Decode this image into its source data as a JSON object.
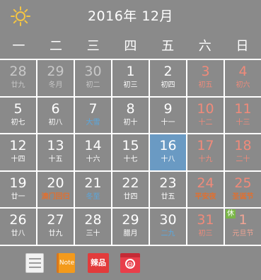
{
  "header": {
    "title": "2016年 12月",
    "weather_icon": "sun-icon"
  },
  "weekdays": [
    "一",
    "二",
    "三",
    "四",
    "五",
    "六",
    "日"
  ],
  "days": [
    {
      "num": "28",
      "lunar": "廿九",
      "other": true
    },
    {
      "num": "29",
      "lunar": "冬月",
      "other": true
    },
    {
      "num": "30",
      "lunar": "初二",
      "other": true
    },
    {
      "num": "1",
      "lunar": "初三"
    },
    {
      "num": "2",
      "lunar": "初四"
    },
    {
      "num": "3",
      "lunar": "初五",
      "weekend": true
    },
    {
      "num": "4",
      "lunar": "初六",
      "weekend": true
    },
    {
      "num": "5",
      "lunar": "初七"
    },
    {
      "num": "6",
      "lunar": "初八"
    },
    {
      "num": "7",
      "lunar": "大雪",
      "type": "term"
    },
    {
      "num": "8",
      "lunar": "初十"
    },
    {
      "num": "9",
      "lunar": "十一"
    },
    {
      "num": "10",
      "lunar": "十二",
      "weekend": true
    },
    {
      "num": "11",
      "lunar": "十三",
      "weekend": true
    },
    {
      "num": "12",
      "lunar": "十四"
    },
    {
      "num": "13",
      "lunar": "十五"
    },
    {
      "num": "14",
      "lunar": "十六"
    },
    {
      "num": "15",
      "lunar": "十七"
    },
    {
      "num": "16",
      "lunar": "十八",
      "selected": true
    },
    {
      "num": "17",
      "lunar": "十九",
      "weekend": true
    },
    {
      "num": "18",
      "lunar": "二十",
      "weekend": true
    },
    {
      "num": "19",
      "lunar": "廿一"
    },
    {
      "num": "20",
      "lunar": "澳门回归",
      "type": "festival"
    },
    {
      "num": "21",
      "lunar": "冬至",
      "type": "term"
    },
    {
      "num": "22",
      "lunar": "廿四"
    },
    {
      "num": "23",
      "lunar": "廿五"
    },
    {
      "num": "24",
      "lunar": "平安夜",
      "type": "festival",
      "weekend": true
    },
    {
      "num": "25",
      "lunar": "圣诞节",
      "type": "festival",
      "weekend": true
    },
    {
      "num": "26",
      "lunar": "廿八"
    },
    {
      "num": "27",
      "lunar": "廿九"
    },
    {
      "num": "28",
      "lunar": "三十"
    },
    {
      "num": "29",
      "lunar": "腊月"
    },
    {
      "num": "30",
      "lunar": "二九",
      "type": "term"
    },
    {
      "num": "31",
      "lunar": "初三",
      "weekend": true
    },
    {
      "num": "1",
      "lunar": "元旦节",
      "other": true,
      "weekend": true,
      "rest": "休"
    }
  ],
  "toolbar": {
    "note_label": "Note",
    "pin_label": "辣品",
    "box_label": "⊖",
    "icons": [
      "list-icon",
      "note-icon",
      "pin-app-icon",
      "toolbox-icon"
    ]
  },
  "colors": {
    "background": "#8a8a8a",
    "selected": "#6a9ac3",
    "weekend": "#f08a7a",
    "festival": "#e07030",
    "term": "#58a8e0",
    "rest_badge": "#7ab648"
  }
}
